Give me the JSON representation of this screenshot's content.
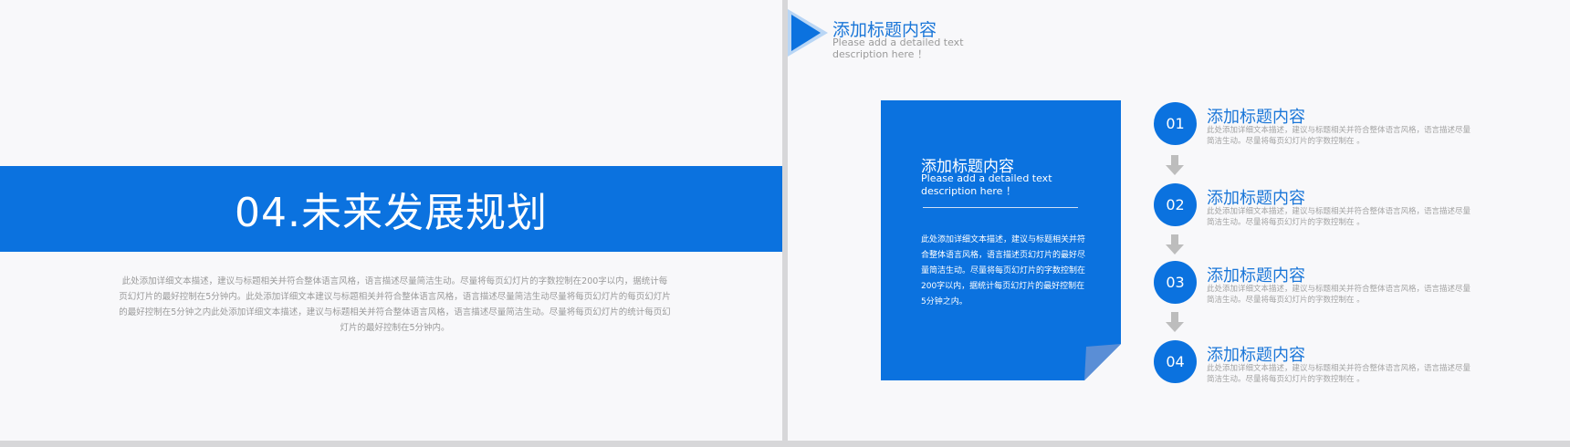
{
  "left_slide": {
    "banner_title": "04.未来发展规划",
    "description": "此处添加详细文本描述，建议与标题相关并符合整体语言风格，语言描述尽量简洁生动。尽量将每页幻灯片的字数控制在200字以内，据统计每页幻灯片的最好控制在5分钟内。此处添加详细文本建议与标题相关并符合整体语言风格，语言描述尽量简洁生动尽量将每页幻灯片的每页幻灯片的最好控制在5分钟之内此处添加详细文本描述，建议与标题相关并符合整体语言风格，语言描述尽量简洁生动。尽量将每页幻灯片的统计每页幻灯片的最好控制在5分钟内。"
  },
  "right_slide": {
    "header": {
      "title": "添加标题内容",
      "subtitle": "Please add a detailed text description here ！"
    },
    "card": {
      "title": "添加标题内容",
      "subtitle": "Please add a detailed text description here ！",
      "body": "此处添加详细文本描述，建议与标题相关并符合整体语言风格，语言描述页幻灯片的最好尽量简洁生动。尽量将每页幻灯片的字数控制在 200字以内，据统计每页幻灯片的最好控制在5分钟之内。"
    },
    "steps": [
      {
        "number": "01",
        "title": "添加标题内容",
        "desc": "此处添加详细文本描述，建议与标题相关并符合整体语言风格，语言描述尽量简洁生动。尽量将每页幻灯片的字数控制在 。"
      },
      {
        "number": "02",
        "title": "添加标题内容",
        "desc": "此处添加详细文本描述，建议与标题相关并符合整体语言风格，语言描述尽量简洁生动。尽量将每页幻灯片的字数控制在 。"
      },
      {
        "number": "03",
        "title": "添加标题内容",
        "desc": "此处添加详细文本描述，建议与标题相关并符合整体语言风格，语言描述尽量简洁生动。尽量将每页幻灯片的字数控制在 。"
      },
      {
        "number": "04",
        "title": "添加标题内容",
        "desc": "此处添加详细文本描述，建议与标题相关并符合整体语言风格，语言描述尽量简洁生动。尽量将每页幻灯片的字数控制在 。"
      }
    ]
  },
  "colors": {
    "accent": "#0b72df",
    "heading_blue": "#1a76d8",
    "muted_text": "#9a9a9a",
    "arrow_gray": "#bdbdbd",
    "page_background": "#f8f8fa"
  },
  "icons": [
    "triangle-pointer-icon",
    "down-arrow-icon",
    "folded-corner-icon"
  ]
}
